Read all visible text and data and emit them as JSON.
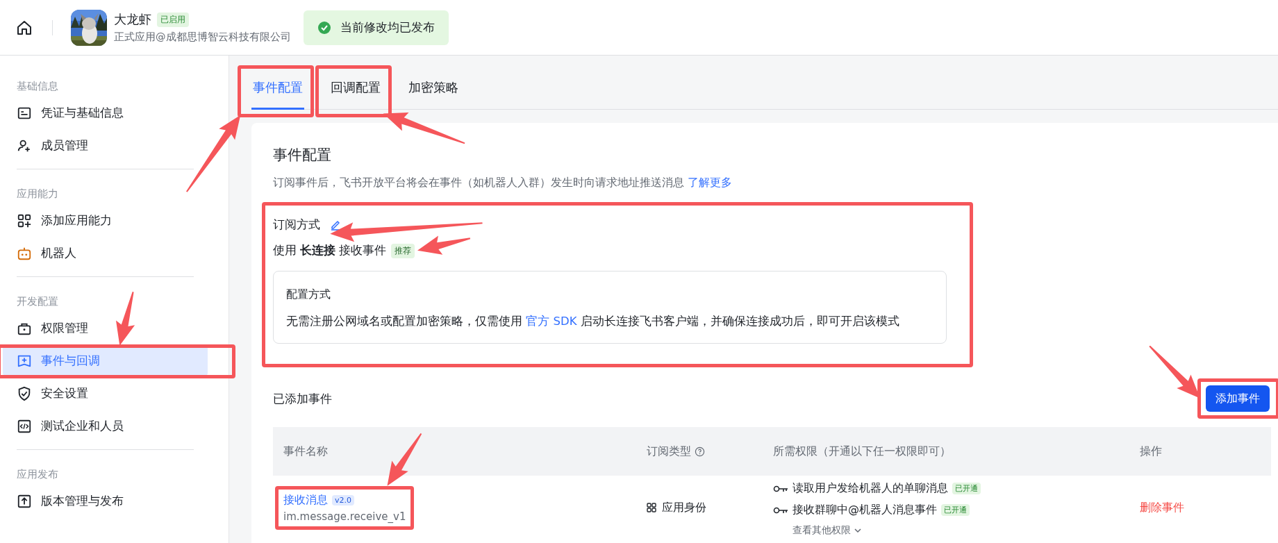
{
  "header": {
    "app_name": "大龙虾",
    "status_badge": "已启用",
    "app_subtitle": "正式应用@成都思博智云科技有限公司",
    "publish_notice": "当前修改均已发布"
  },
  "sidebar": {
    "groups": [
      {
        "label": "基础信息",
        "items": [
          {
            "label": "凭证与基础信息",
            "selected": false
          },
          {
            "label": "成员管理",
            "selected": false
          }
        ]
      },
      {
        "label": "应用能力",
        "items": [
          {
            "label": "添加应用能力",
            "selected": false
          },
          {
            "label": "机器人",
            "selected": false
          }
        ]
      },
      {
        "label": "开发配置",
        "items": [
          {
            "label": "权限管理",
            "selected": false
          },
          {
            "label": "事件与回调",
            "selected": true,
            "annotation": {
              "box": true,
              "arrow": true
            }
          },
          {
            "label": "安全设置",
            "selected": false
          },
          {
            "label": "测试企业和人员",
            "selected": false
          }
        ]
      },
      {
        "label": "应用发布",
        "items": [
          {
            "label": "版本管理与发布",
            "selected": false
          }
        ]
      }
    ]
  },
  "tabs": [
    {
      "label": "事件配置",
      "selected": true,
      "annotation": {
        "box": true,
        "arrow": true
      }
    },
    {
      "label": "回调配置",
      "selected": false,
      "annotation": {
        "box": true,
        "arrow": true
      }
    },
    {
      "label": "加密策略",
      "selected": false
    }
  ],
  "event_config": {
    "title": "事件配置",
    "description": "订阅事件后，飞书开放平台将会在事件（如机器人入群）发生时向请求地址推送消息 ",
    "learn_more_link": "了解更多",
    "subscription": {
      "label": "订阅方式",
      "annotation": {
        "box": true
      },
      "edit_annotation": {
        "arrow": true
      },
      "mode_text": "使用 **长连接** 接收事件",
      "mode_badge": "推荐",
      "badge_annotation": {
        "arrow": true
      },
      "method_box": {
        "title": "配置方式",
        "text_before": "无需注册公网域名或配置加密策略，仅需使用 ",
        "link": "官方 SDK",
        "text_after": " 启动长连接飞书客户端，并确保连接成功后，即可开启该模式"
      }
    },
    "added_events": {
      "title": "已添加事件",
      "add_button": {
        "label": "添加事件",
        "annotation": {
          "box": true,
          "arrow": true
        }
      },
      "table": {
        "columns": [
          {
            "label": "事件名称"
          },
          {
            "label": "订阅类型",
            "help_icon": true
          },
          {
            "label": "所需权限（开通以下任一权限即可）"
          },
          {
            "label": "操作"
          }
        ],
        "rows": [
          {
            "event_name": "接收消息",
            "version": "v2.0",
            "event_key": "im.message.receive_v1",
            "annotation": {
              "box": true,
              "arrow": true
            },
            "subscription_type": "应用身份",
            "permissions": [
              {
                "name": "读取用户发给机器人的单聊消息",
                "status": "已开通"
              },
              {
                "name": "接收群聊中@机器人消息事件",
                "status": "已开通"
              }
            ],
            "more_permissions": "查看其他权限",
            "action": "删除事件"
          }
        ]
      }
    }
  }
}
